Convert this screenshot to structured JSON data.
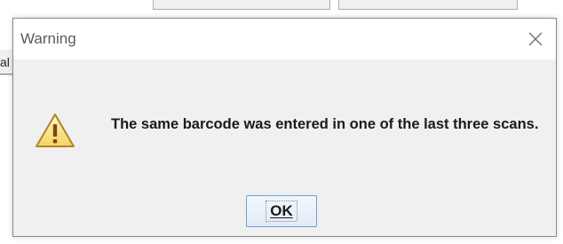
{
  "background": {
    "fragment_text": "al"
  },
  "dialog": {
    "title": "Warning",
    "icon": "warning-triangle-icon",
    "message": "The same barcode was entered in one of the last three scans.",
    "ok_label": "OK",
    "close_icon": "close-icon"
  },
  "colors": {
    "warning_fill": "#f7e27a",
    "warning_stroke": "#b3832a",
    "button_border": "#6aa2d8"
  }
}
